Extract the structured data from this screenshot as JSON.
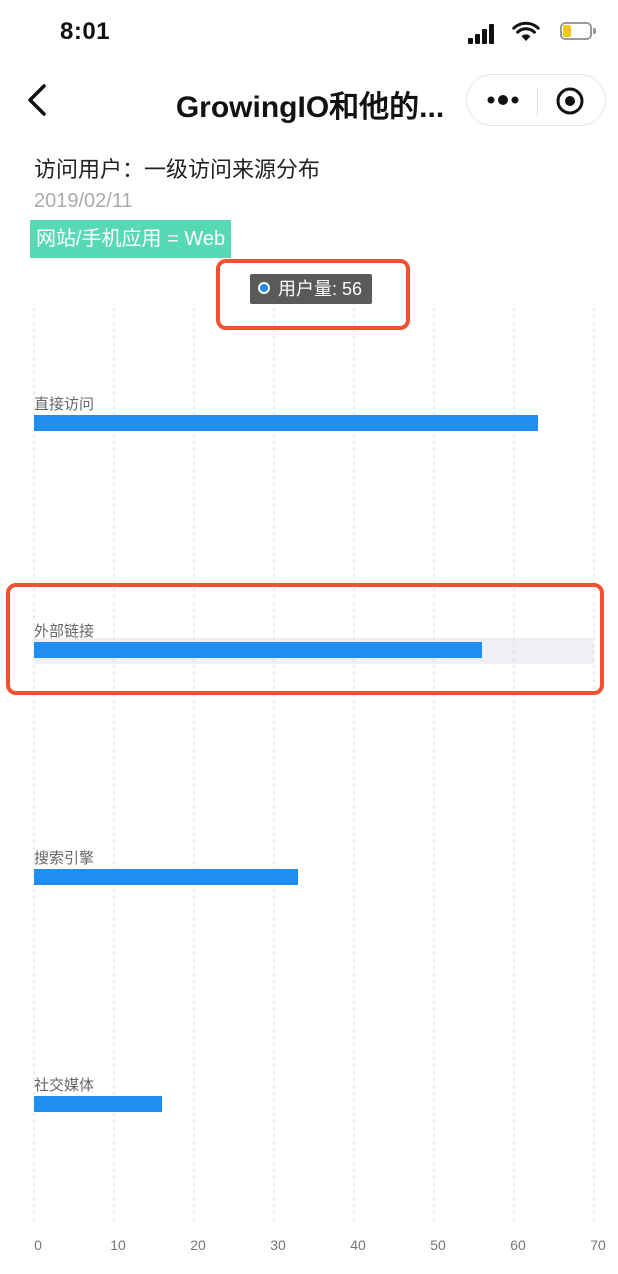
{
  "status_bar": {
    "time": "8:01"
  },
  "nav": {
    "title": "GrowingIO和他的..."
  },
  "header": {
    "title": "访问用户：一级访问来源分布",
    "date": "2019/02/11",
    "filter_tag": "网站/手机应用 = Web"
  },
  "tooltip": {
    "label": "用户量: 56"
  },
  "colors": {
    "bar": "#1f8ef1",
    "filter_tag": "#58d9b5",
    "highlight": "#f05133",
    "hover_band": "#eef0f5"
  },
  "chart_data": {
    "type": "bar",
    "orientation": "horizontal",
    "categories": [
      "直接访问",
      "外部链接",
      "搜索引擎",
      "社交媒体"
    ],
    "series": [
      {
        "name": "用户量",
        "values": [
          63,
          56,
          33,
          16
        ]
      }
    ],
    "xlim": [
      0,
      70
    ],
    "xticks": [
      0,
      10,
      20,
      30,
      40,
      50,
      60,
      70
    ],
    "grid": true,
    "highlighted_category": "外部链接"
  }
}
